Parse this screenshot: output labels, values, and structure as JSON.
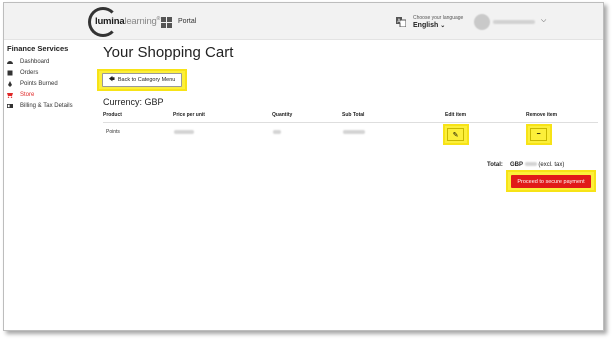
{
  "header": {
    "logo_text": "lumina",
    "logo_text_2": "learning",
    "logo_tm": "®",
    "portal_label": "Portal",
    "language_caption": "Choose your language",
    "language_value": "English",
    "chevron": "⌄"
  },
  "sidebar": {
    "title": "Finance Services",
    "items": [
      {
        "label": "Dashboard",
        "icon": "dashboard-icon"
      },
      {
        "label": "Orders",
        "icon": "orders-icon"
      },
      {
        "label": "Points Burned",
        "icon": "flame-icon"
      },
      {
        "label": "Store",
        "icon": "store-icon",
        "active": true
      },
      {
        "label": "Billing & Tax Details",
        "icon": "id-card-icon"
      }
    ]
  },
  "main": {
    "title": "Your Shopping Cart",
    "back_button": "Back to Category Menu",
    "back_arrow": "🠔",
    "currency": "Currency: GBP",
    "columns": [
      "Product",
      "Price per unit",
      "Quantity",
      "Sub Total",
      "Edit item",
      "Remove item"
    ],
    "row": {
      "product": "Points"
    },
    "edit_glyph": "✎",
    "remove_glyph": "−",
    "total_label": "Total:",
    "total_prefix": "GBP",
    "total_suffix": "(excl. tax)",
    "pay_button": "Proceed to secure payment"
  },
  "colors": {
    "highlight": "#fcef3a",
    "accent_red": "#e11919",
    "active_nav": "#e02828"
  }
}
